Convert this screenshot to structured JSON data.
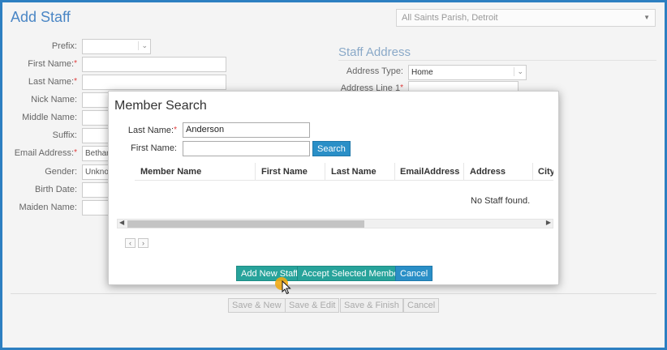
{
  "page": {
    "title": "Add Staff",
    "parish_select": {
      "value": "All Saints Parish, Detroit",
      "icon": "chevron-down-icon"
    }
  },
  "staff_form": {
    "prefix": {
      "label": "Prefix:",
      "value": ""
    },
    "first_name": {
      "label": "First Name:",
      "required": "*",
      "value": ""
    },
    "last_name": {
      "label": "Last Name:",
      "required": "*",
      "value": ""
    },
    "nick_name": {
      "label": "Nick Name:",
      "value": ""
    },
    "middle_name": {
      "label": "Middle Name:",
      "value": ""
    },
    "suffix": {
      "label": "Suffix:",
      "value": ""
    },
    "email": {
      "label": "Email Address:",
      "required": "*",
      "value": "Bethar"
    },
    "gender": {
      "label": "Gender:",
      "value": "Unkno"
    },
    "birth_date": {
      "label": "Birth Date:",
      "value": ""
    },
    "maiden_name": {
      "label": "Maiden Name:",
      "value": ""
    }
  },
  "staff_address": {
    "section_title": "Staff Address",
    "address_type": {
      "label": "Address Type:",
      "value": "Home"
    },
    "address_line1": {
      "label": "Address Line 1",
      "required": "*",
      "value": ""
    }
  },
  "footer_buttons": {
    "save_new": "Save & New",
    "save_edit": "Save & Edit",
    "save_finish": "Save & Finish",
    "cancel": "Cancel"
  },
  "member_search": {
    "title": "Member Search",
    "last_name": {
      "label": "Last Name:",
      "required": "*",
      "value": "Anderson"
    },
    "first_name": {
      "label": "First Name:",
      "value": ""
    },
    "search_button": "Search",
    "columns": [
      "Member Name",
      "First Name",
      "Last Name",
      "EmailAddress",
      "Address",
      "City"
    ],
    "empty_message": "No Staff found.",
    "buttons": {
      "add_new_staff": "Add New Staff",
      "accept_selected": "Accept Selected Member",
      "cancel": "Cancel"
    }
  },
  "colors": {
    "window_border": "#2d7fc1",
    "title_blue": "#4a86c5",
    "primary_button": "#2a8fc7",
    "teal_button": "#27a39b",
    "required_marker": "#e03a3a"
  }
}
